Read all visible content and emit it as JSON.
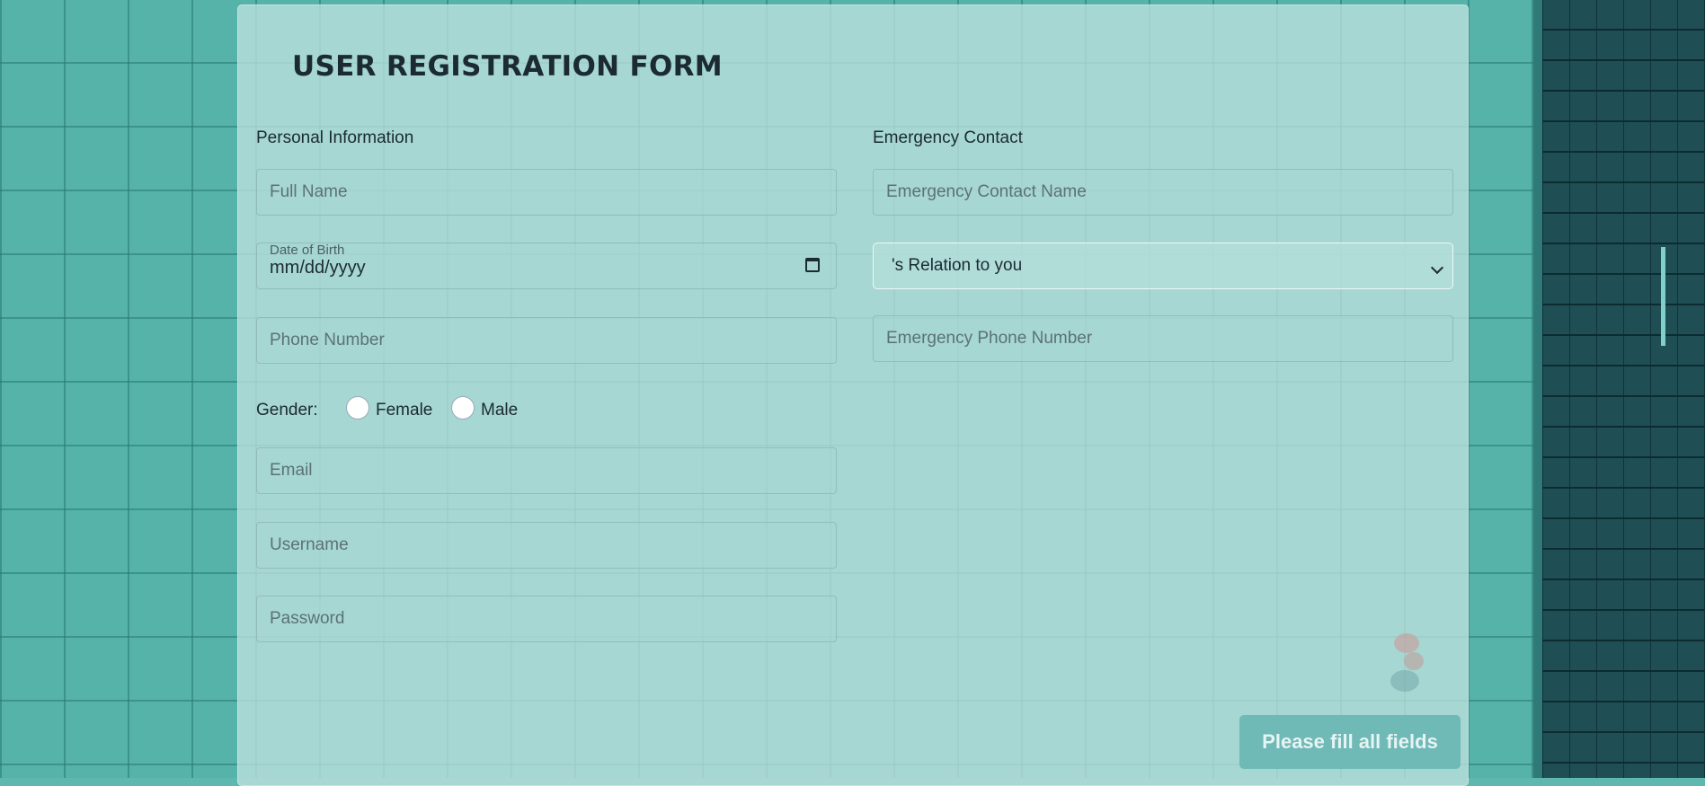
{
  "form": {
    "title": "USER REGISTRATION FORM",
    "personal_section": "Personal Information",
    "emergency_section": "Emergency Contact",
    "full_name_placeholder": "Full Name",
    "dob_label": "Date of Birth",
    "dob_value": "mm/dd/yyyy",
    "phone_placeholder": "Phone Number",
    "gender_label": "Gender:",
    "gender_options": [
      "Female",
      "Male"
    ],
    "email_placeholder": "Email",
    "username_placeholder": "Username",
    "password_placeholder": "Password",
    "emergency_name_placeholder": "Emergency Contact Name",
    "relation_selected": "'s Relation to you",
    "emergency_phone_placeholder": "Emergency Phone Number",
    "submit_label": "Please fill all fields"
  },
  "colors": {
    "background": "#55b3aa",
    "card": "#bee1de",
    "button": "#6fb9b6",
    "text": "#1b2a33"
  }
}
